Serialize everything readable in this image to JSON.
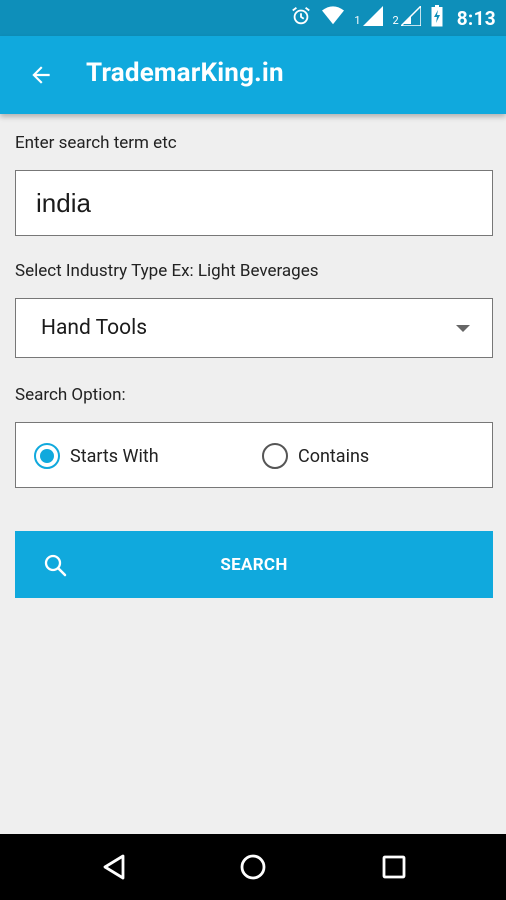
{
  "status_bar": {
    "time": "8:13",
    "sim1": "1",
    "sim2": "2",
    "icons": [
      "alarm-icon",
      "wifi-icon",
      "signal-icon",
      "battery-icon"
    ]
  },
  "app_bar": {
    "title": "TrademarKing.in",
    "back_icon": "arrow-back-icon"
  },
  "form": {
    "search_label": "Enter search term etc",
    "search_value": "india",
    "industry_label": "Select Industry Type Ex: Light Beverages",
    "industry_value": "Hand Tools",
    "option_label": "Search Option:",
    "options": [
      {
        "label": "Starts With",
        "checked": true
      },
      {
        "label": "Contains",
        "checked": false
      }
    ],
    "search_button": "SEARCH"
  },
  "nav_bar": {
    "icons": [
      "back-triangle-icon",
      "home-circle-icon",
      "recents-square-icon"
    ]
  },
  "colors": {
    "accent": "#10a9dd",
    "status_bar": "#0e8fba",
    "background": "#efefef"
  }
}
